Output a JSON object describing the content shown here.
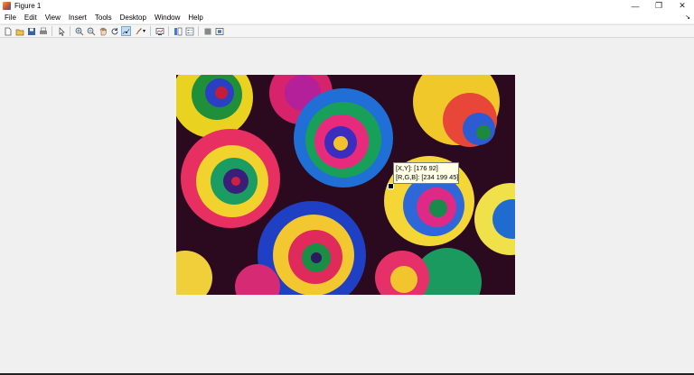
{
  "window": {
    "title": "Figure 1",
    "controls": {
      "minimize": "—",
      "maximize": "❐",
      "close": "✕"
    }
  },
  "menu": {
    "items": [
      "File",
      "Edit",
      "View",
      "Insert",
      "Tools",
      "Desktop",
      "Window",
      "Help"
    ],
    "dock_arrow": "↘"
  },
  "toolbar": {
    "buttons": [
      "new-figure-icon",
      "open-file-icon",
      "save-icon",
      "print-icon",
      "pointer-icon",
      "zoom-in-icon",
      "zoom-out-icon",
      "pan-icon",
      "rotate-3d-icon",
      "data-cursor-icon",
      "brush-icon",
      "link-plot-icon",
      "insert-colorbar-icon",
      "insert-legend-icon",
      "hide-plot-tools-icon",
      "show-plot-tools-icon"
    ],
    "active_button": "data-cursor-icon"
  },
  "datatip": {
    "line1": "[X,Y]: [176 92]",
    "line2": "[R,G,B]: [234 199 45]"
  }
}
